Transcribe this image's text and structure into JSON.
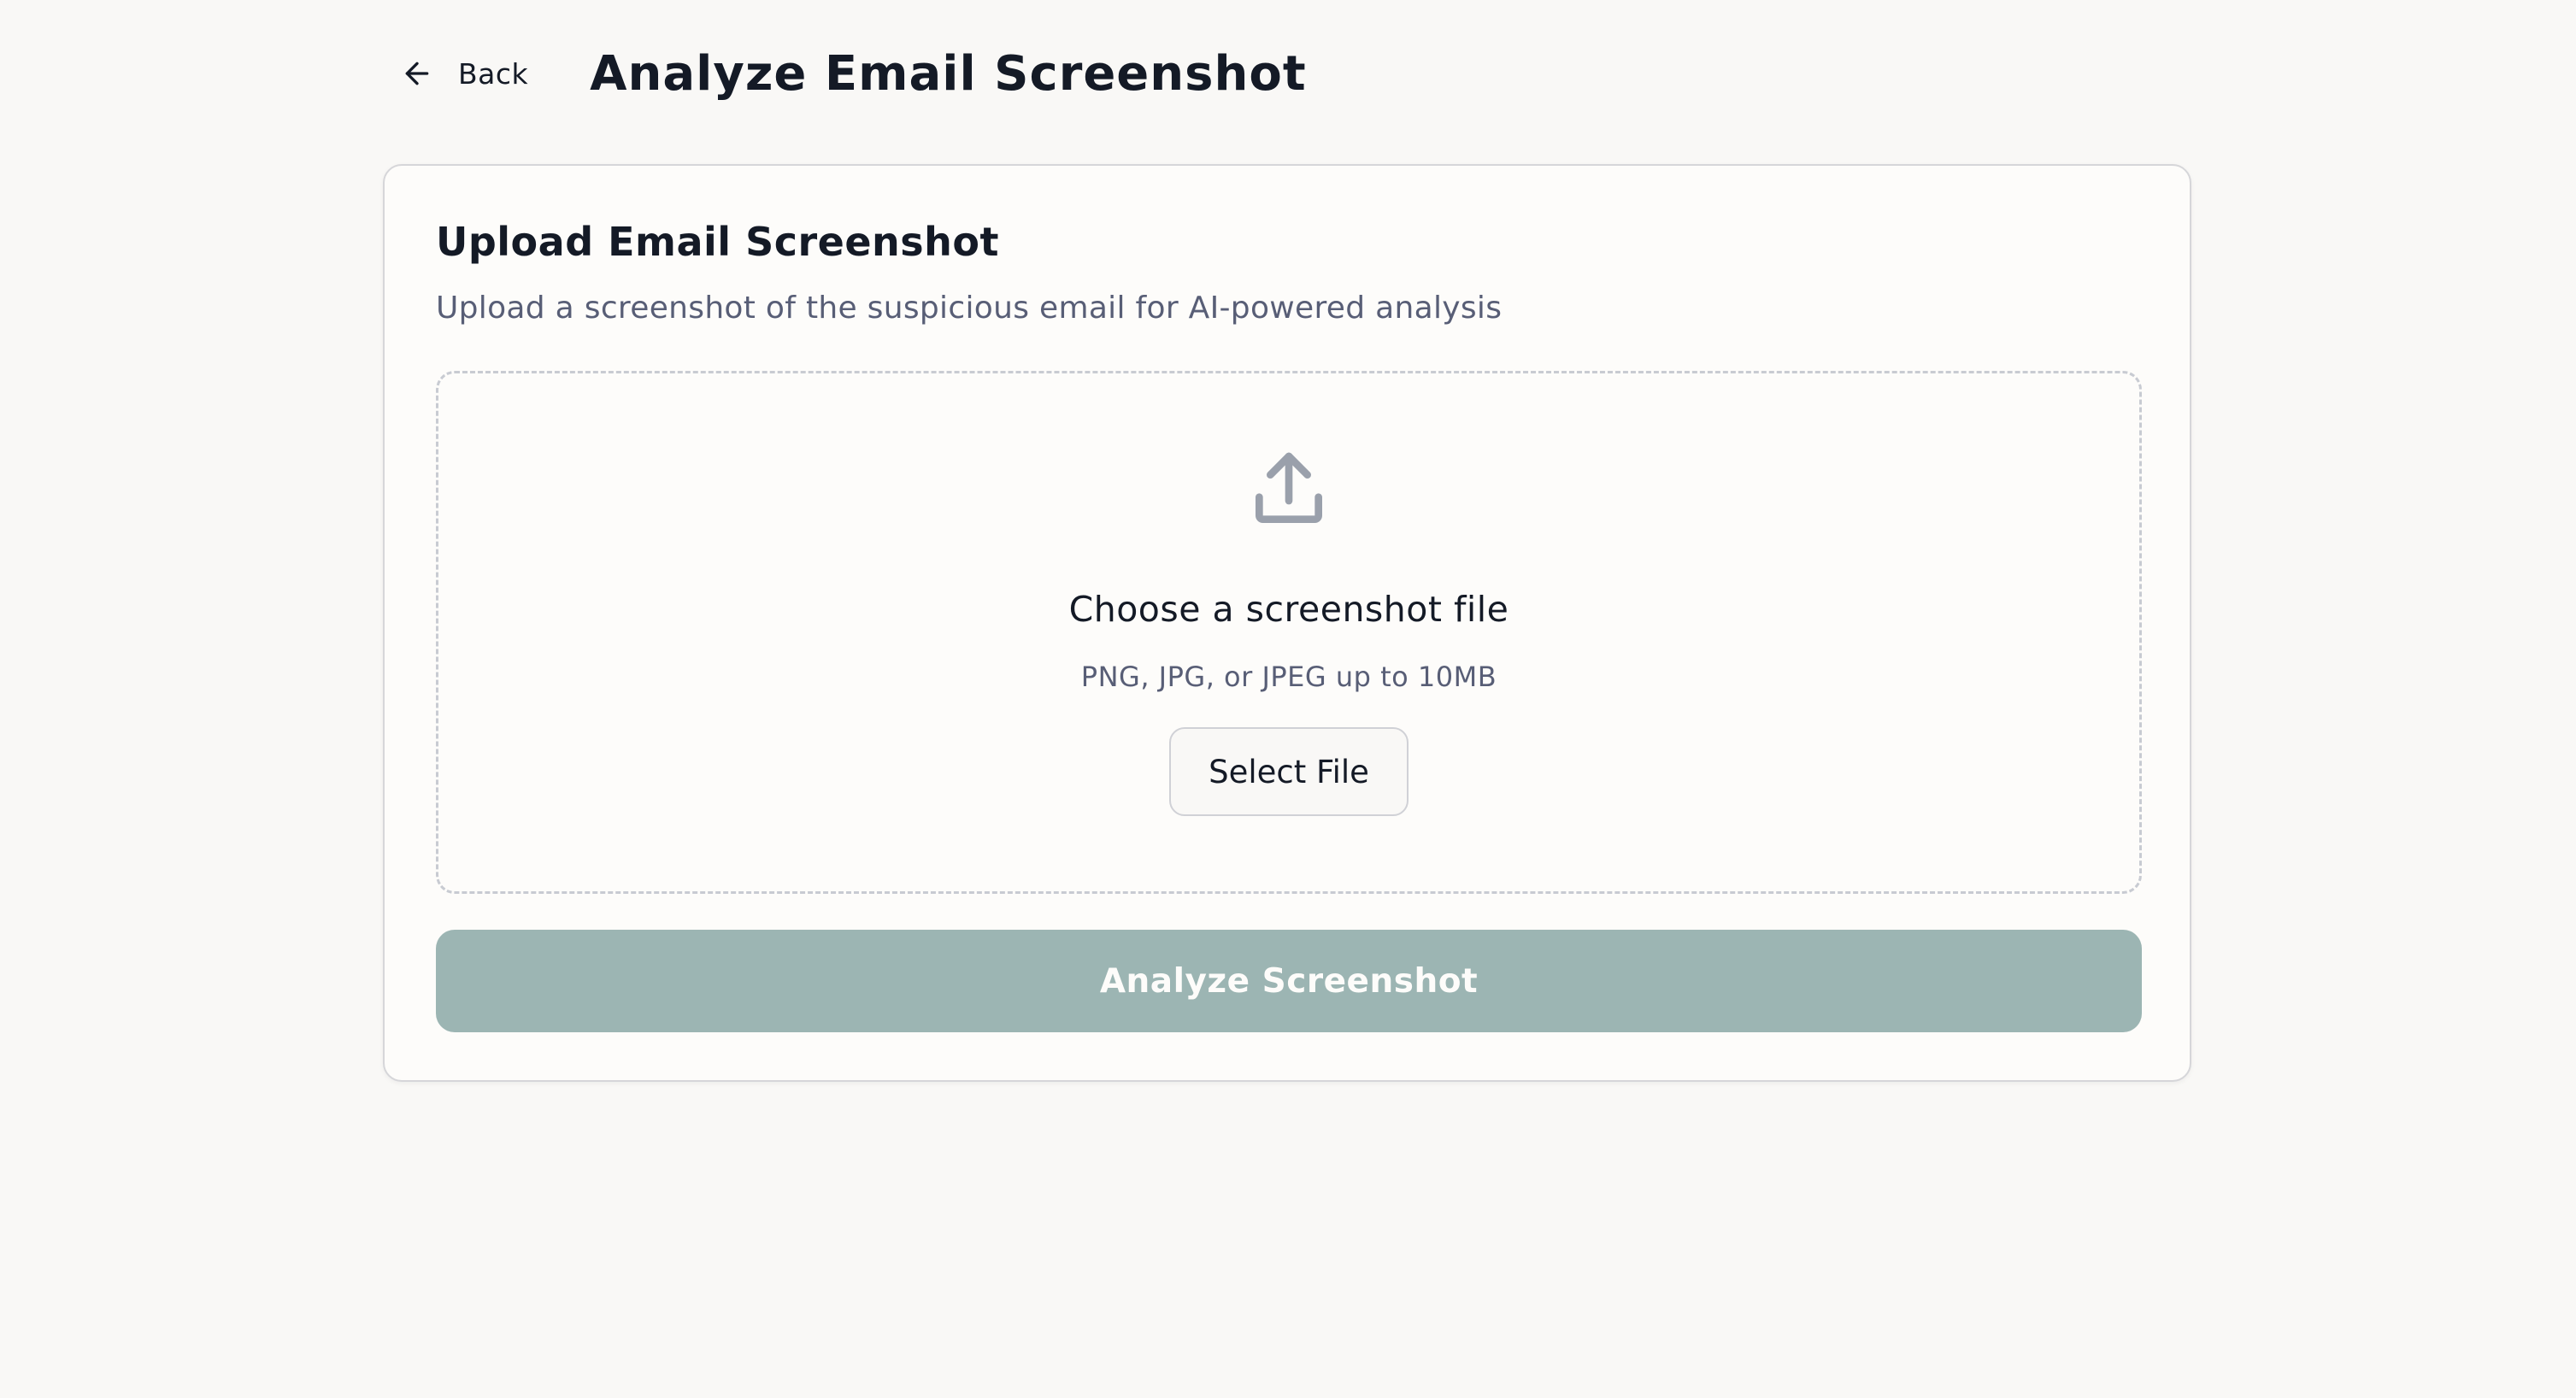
{
  "header": {
    "back_label": "Back",
    "back_icon": "arrow-left-icon",
    "title": "Analyze Email Screenshot"
  },
  "card": {
    "title": "Upload Email Screenshot",
    "subtitle": "Upload a screenshot of the suspicious email for AI-powered analysis"
  },
  "dropzone": {
    "icon": "upload-icon",
    "heading": "Choose a screenshot file",
    "hint": "PNG, JPG, or JPEG up to 10MB",
    "select_label": "Select File"
  },
  "actions": {
    "analyze_label": "Analyze Screenshot",
    "analyze_state": "disabled"
  },
  "colors": {
    "background": "#f9f8f6",
    "card": "#fdfcfa",
    "text": "#141a26",
    "muted_text": "#585e76",
    "icon": "#9aa0ab",
    "analyze_button_disabled": "#9cb5b3"
  }
}
